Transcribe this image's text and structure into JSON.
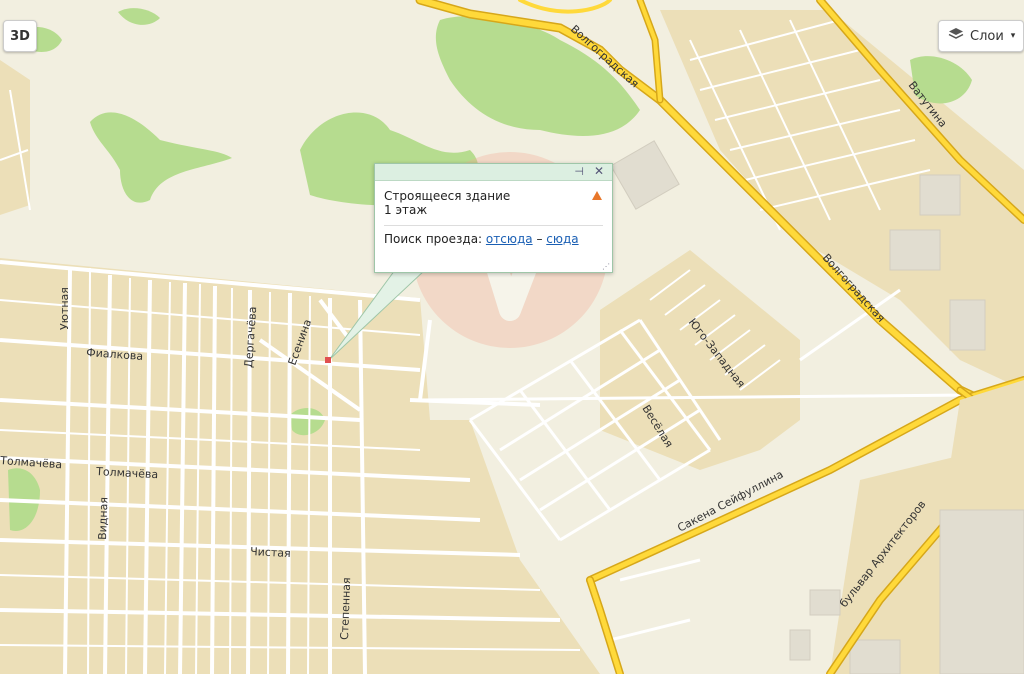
{
  "controls": {
    "btn_3d": "3D",
    "layers_label": "Слои"
  },
  "streets": [
    "Волгоградская",
    "Волгоградская",
    "Ватутина",
    "Юго-Западная",
    "Весёлая",
    "Сакена Сейфуллина",
    "бульвар Архитекторов",
    "Уютная",
    "Фиалкова",
    "Дергачёва",
    "Есенина",
    "Толмачёва",
    "Толмачёва",
    "Видная",
    "Чистая",
    "Степенная"
  ],
  "balloon": {
    "title": "Строящееся здание",
    "floors": "1 этаж",
    "route_label": "Поиск проезда:",
    "from_link": "отсюда",
    "dash": "–",
    "to_link": "сюда"
  },
  "icons": {
    "layers": "layers-icon",
    "close": "close-icon",
    "pin": "pin-icon",
    "warning": "warning-icon"
  },
  "colors": {
    "map_background": "#f2efe0",
    "residential": "#ecdfb8",
    "park": "#b6dc8f",
    "highway": "#ffd93a",
    "link": "#1a5fb4"
  }
}
